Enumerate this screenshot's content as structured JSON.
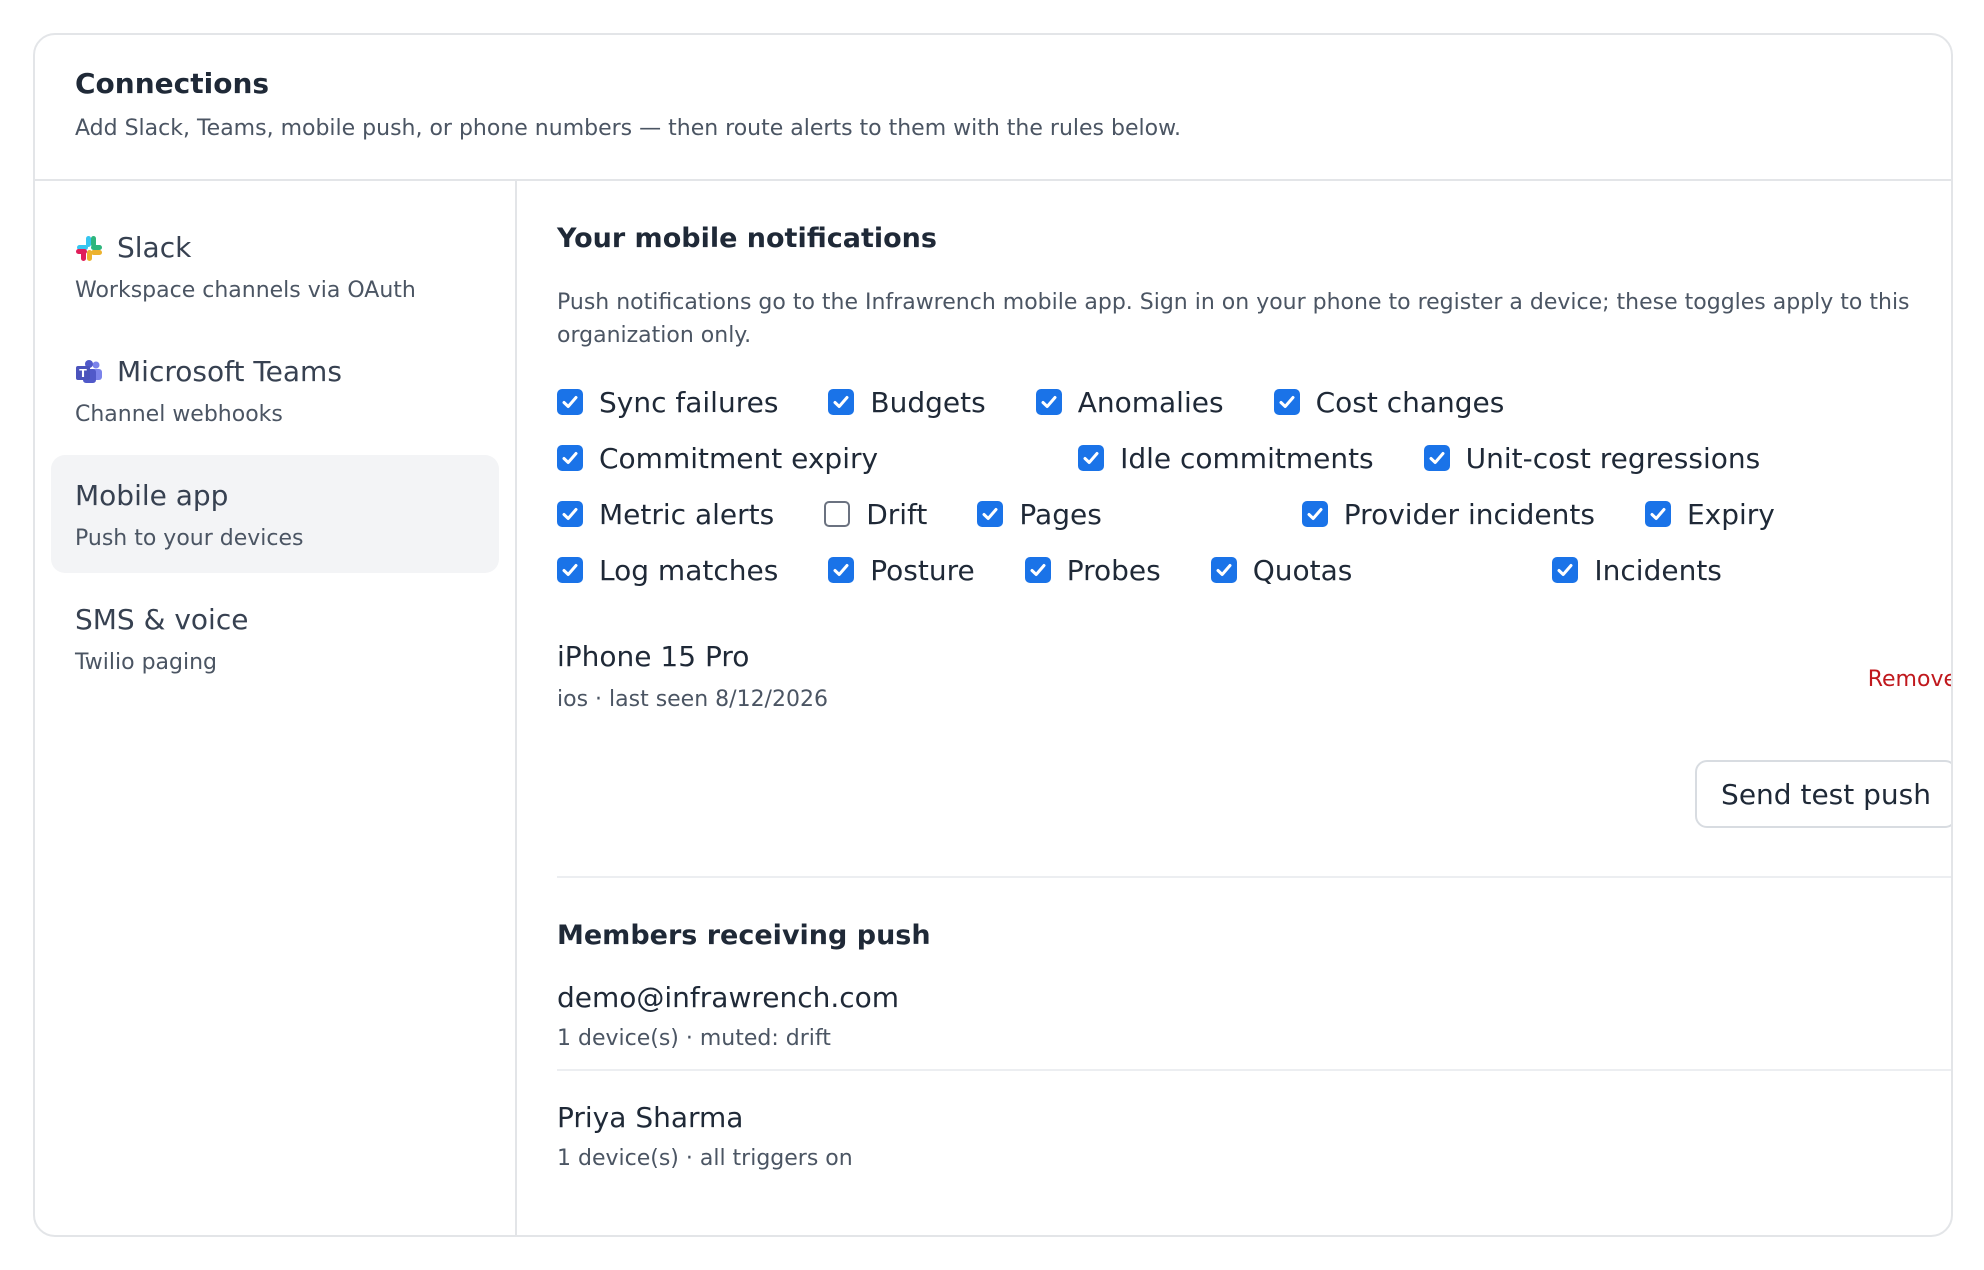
{
  "header": {
    "title": "Connections",
    "subtitle": "Add Slack, Teams, mobile push, or phone numbers — then route alerts to them with the rules below."
  },
  "sidebar": {
    "items": [
      {
        "title": "Slack",
        "desc": "Workspace channels via OAuth",
        "icon": "slack-icon",
        "active": false
      },
      {
        "title": "Microsoft Teams",
        "desc": "Channel webhooks",
        "icon": "teams-icon",
        "active": false
      },
      {
        "title": "Mobile app",
        "desc": "Push to your devices",
        "icon": "",
        "active": true
      },
      {
        "title": "SMS & voice",
        "desc": "Twilio paging",
        "icon": "",
        "active": false
      }
    ]
  },
  "main": {
    "title": "Your mobile notifications",
    "description": "Push notifications go to the Infrawrench mobile app. Sign in on your phone to register a device; these toggles apply to this organization only.",
    "toggles": [
      {
        "label": "Sync failures",
        "checked": true
      },
      {
        "label": "Budgets",
        "checked": true
      },
      {
        "label": "Anomalies",
        "checked": true
      },
      {
        "label": "Cost changes",
        "checked": true
      },
      {
        "label": "Commitment expiry",
        "checked": true
      },
      {
        "label": "Idle commitments",
        "checked": true
      },
      {
        "label": "Unit-cost regressions",
        "checked": true
      },
      {
        "label": "Metric alerts",
        "checked": true
      },
      {
        "label": "Drift",
        "checked": false
      },
      {
        "label": "Pages",
        "checked": true
      },
      {
        "label": "Provider incidents",
        "checked": true
      },
      {
        "label": "Expiry",
        "checked": true
      },
      {
        "label": "Log matches",
        "checked": true
      },
      {
        "label": "Posture",
        "checked": true
      },
      {
        "label": "Probes",
        "checked": true
      },
      {
        "label": "Quotas",
        "checked": true
      },
      {
        "label": "Incidents",
        "checked": true
      }
    ],
    "device": {
      "name": "iPhone 15 Pro",
      "meta": "ios · last seen 8/12/2026",
      "remove_label": "Remove"
    },
    "test_push_label": "Send test push",
    "members_title": "Members receiving push",
    "members": [
      {
        "name": "demo@infrawrench.com",
        "meta": "1 device(s) · muted: drift"
      },
      {
        "name": "Priya Sharma",
        "meta": "1 device(s) · all triggers on"
      }
    ]
  },
  "colors": {
    "accent": "#1a73e8",
    "danger": "#c0181d",
    "active_bg": "#f3f4f6",
    "border": "#e3e5e8"
  }
}
